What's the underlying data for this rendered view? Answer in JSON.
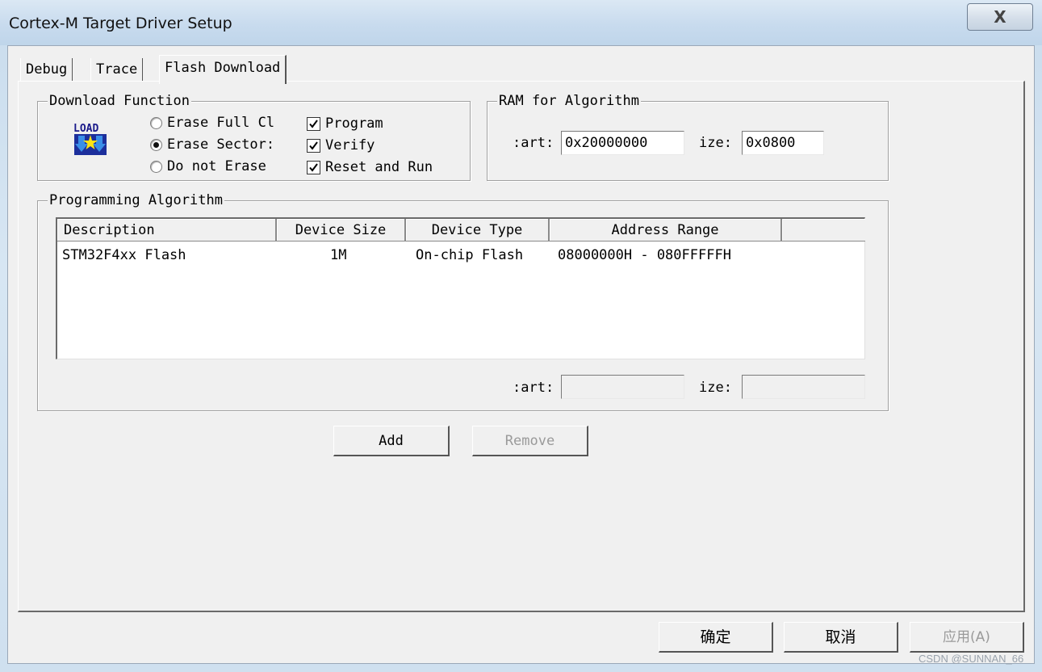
{
  "window": {
    "title": "Cortex-M Target Driver Setup",
    "close_glyph": "X"
  },
  "tabs": [
    {
      "label": "Debug"
    },
    {
      "label": "Trace"
    },
    {
      "label": "Flash Download"
    }
  ],
  "download_function": {
    "label": "Download Function",
    "icon_text": "LOAD",
    "options": [
      {
        "label": "Erase Full Cl",
        "selected": false
      },
      {
        "label": "Erase Sector:",
        "selected": true
      },
      {
        "label": "Do not Erase",
        "selected": false
      }
    ],
    "checks": [
      {
        "label": "Program",
        "checked": true
      },
      {
        "label": "Verify",
        "checked": true
      },
      {
        "label": "Reset and Run",
        "checked": true
      }
    ]
  },
  "ram_for_algorithm": {
    "label": "RAM for Algorithm",
    "start_label": ":art:",
    "start_value": "0x20000000",
    "size_label": "ize:",
    "size_value": "0x0800"
  },
  "programming_algorithm": {
    "label": "Programming Algorithm",
    "columns": [
      "Description",
      "Device Size",
      "Device Type",
      "Address Range"
    ],
    "rows": [
      {
        "description": "STM32F4xx Flash",
        "device_size": "1M",
        "device_type": "On-chip Flash",
        "address_range": "08000000H - 080FFFFFH"
      }
    ],
    "start_label": ":art:",
    "start_value": "",
    "size_label": "ize:",
    "size_value": ""
  },
  "buttons": {
    "add": "Add",
    "remove": "Remove",
    "ok": "确定",
    "cancel": "取消",
    "apply": "应用(A)"
  },
  "watermark": "CSDN @SUNNAN_66"
}
